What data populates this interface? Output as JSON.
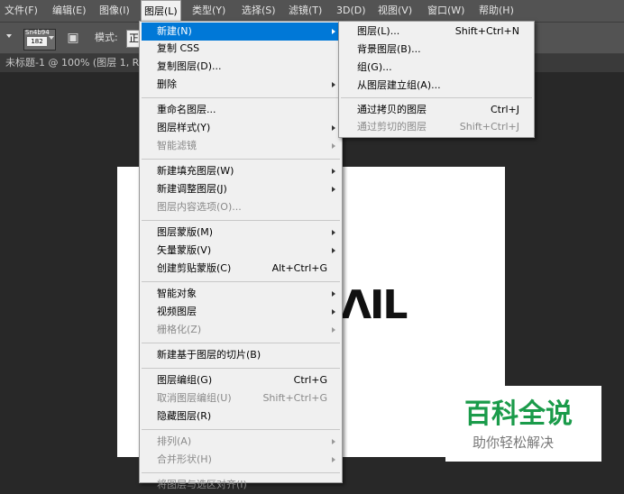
{
  "menubar": [
    {
      "label": "文件(F)",
      "active": false
    },
    {
      "label": "编辑(E)",
      "active": false
    },
    {
      "label": "图像(I)",
      "active": false
    },
    {
      "label": "图层(L)",
      "active": true
    },
    {
      "label": "类型(Y)",
      "active": false
    },
    {
      "label": "选择(S)",
      "active": false
    },
    {
      "label": "滤镜(T)",
      "active": false
    },
    {
      "label": "3D(D)",
      "active": false
    },
    {
      "label": "视图(V)",
      "active": false
    },
    {
      "label": "窗口(W)",
      "active": false
    },
    {
      "label": "帮助(H)",
      "active": false
    }
  ],
  "options": {
    "brush_preset_label": "Sn4b94",
    "brush_size": "182",
    "mode_label": "模式:",
    "mode_value": "正"
  },
  "document": {
    "tab_title": "未标题-1 @ 100% (图层 1, R"
  },
  "canvas": {
    "text": "ΛIL"
  },
  "watermark": {
    "title": "百科全说",
    "subtitle": "助你轻松解决"
  },
  "layer_menu": {
    "items": [
      {
        "label": "新建(N)",
        "shortcut": "",
        "submenu": true,
        "disabled": false,
        "highlighted": true
      },
      {
        "label": "复制 CSS",
        "shortcut": "",
        "submenu": false,
        "disabled": false,
        "highlighted": false
      },
      {
        "label": "复制图层(D)...",
        "shortcut": "",
        "submenu": false,
        "disabled": false,
        "highlighted": false
      },
      {
        "label": "删除",
        "shortcut": "",
        "submenu": true,
        "disabled": false,
        "highlighted": false
      },
      {
        "label": "重命名图层...",
        "shortcut": "",
        "submenu": false,
        "disabled": false,
        "highlighted": false
      },
      {
        "label": "图层样式(Y)",
        "shortcut": "",
        "submenu": true,
        "disabled": false,
        "highlighted": false
      },
      {
        "label": "智能滤镜",
        "shortcut": "",
        "submenu": true,
        "disabled": true,
        "highlighted": false
      },
      {
        "label": "新建填充图层(W)",
        "shortcut": "",
        "submenu": true,
        "disabled": false,
        "highlighted": false
      },
      {
        "label": "新建调整图层(J)",
        "shortcut": "",
        "submenu": true,
        "disabled": false,
        "highlighted": false
      },
      {
        "label": "图层内容选项(O)...",
        "shortcut": "",
        "submenu": false,
        "disabled": true,
        "highlighted": false
      },
      {
        "label": "图层蒙版(M)",
        "shortcut": "",
        "submenu": true,
        "disabled": false,
        "highlighted": false
      },
      {
        "label": "矢量蒙版(V)",
        "shortcut": "",
        "submenu": true,
        "disabled": false,
        "highlighted": false
      },
      {
        "label": "创建剪贴蒙版(C)",
        "shortcut": "Alt+Ctrl+G",
        "submenu": false,
        "disabled": false,
        "highlighted": false
      },
      {
        "label": "智能对象",
        "shortcut": "",
        "submenu": true,
        "disabled": false,
        "highlighted": false
      },
      {
        "label": "视频图层",
        "shortcut": "",
        "submenu": true,
        "disabled": false,
        "highlighted": false
      },
      {
        "label": "栅格化(Z)",
        "shortcut": "",
        "submenu": true,
        "disabled": true,
        "highlighted": false
      },
      {
        "label": "新建基于图层的切片(B)",
        "shortcut": "",
        "submenu": false,
        "disabled": false,
        "highlighted": false
      },
      {
        "label": "图层编组(G)",
        "shortcut": "Ctrl+G",
        "submenu": false,
        "disabled": false,
        "highlighted": false
      },
      {
        "label": "取消图层编组(U)",
        "shortcut": "Shift+Ctrl+G",
        "submenu": false,
        "disabled": true,
        "highlighted": false
      },
      {
        "label": "隐藏图层(R)",
        "shortcut": "",
        "submenu": false,
        "disabled": false,
        "highlighted": false
      },
      {
        "label": "排列(A)",
        "shortcut": "",
        "submenu": true,
        "disabled": true,
        "highlighted": false
      },
      {
        "label": "合并形状(H)",
        "shortcut": "",
        "submenu": true,
        "disabled": true,
        "highlighted": false
      },
      {
        "label": "将图层与选区对齐(I)",
        "shortcut": "",
        "submenu": true,
        "disabled": true,
        "highlighted": false
      }
    ]
  },
  "new_submenu": {
    "items": [
      {
        "label": "图层(L)...",
        "shortcut": "Shift+Ctrl+N",
        "disabled": false
      },
      {
        "label": "背景图层(B)...",
        "shortcut": "",
        "disabled": false
      },
      {
        "label": "组(G)...",
        "shortcut": "",
        "disabled": false
      },
      {
        "label": "从图层建立组(A)...",
        "shortcut": "",
        "disabled": false
      },
      {
        "label": "通过拷贝的图层",
        "shortcut": "Ctrl+J",
        "disabled": false
      },
      {
        "label": "通过剪切的图层",
        "shortcut": "Shift+Ctrl+J",
        "disabled": true
      }
    ]
  }
}
